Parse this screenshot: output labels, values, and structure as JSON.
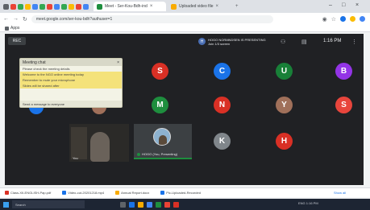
{
  "browser": {
    "tabs": [
      {
        "label": "Meet - Ser-Kou-Bdh-ind",
        "active": true,
        "favicon_color": "#1e8e3e"
      },
      {
        "label": "Uploaded video file",
        "active": false,
        "favicon_color": "#f9ab00"
      }
    ],
    "url": "meet.google.com/ser-kou-bdh?authuser=1",
    "bookmarks_label": "Apps"
  },
  "meet": {
    "title_chip": "REC",
    "presenter_line1": "HOGO NORMNDSEN IS PRESENTING",
    "presenter_line2": "Join 1/3 screen",
    "clock": "1:16 PM",
    "chat": {
      "header": "Meeting chat",
      "rows": [
        "Please check the meeting details",
        "Welcome to the NGO online meeting today",
        "Remember to mute your microphone",
        "Slides will be shared after"
      ],
      "footer": "Send a message to everyone"
    },
    "self_label": "You",
    "presenting_label": "HOGO (You, Presenting)",
    "participants": [
      {
        "initial": "S",
        "color": "#d93025"
      },
      {
        "initial": "C",
        "color": "#1a73e8"
      },
      {
        "initial": "U",
        "color": "#188038"
      },
      {
        "initial": "B",
        "color": "#9334e6"
      },
      {
        "initial": "M",
        "color": "#1e8e3e"
      },
      {
        "initial": "N",
        "color": "#d93025"
      },
      {
        "initial": "Y",
        "color": "#a0705a"
      },
      {
        "initial": "S",
        "color": "#e8453c"
      },
      {
        "initial": "K",
        "color": "#80868b"
      },
      {
        "initial": "H",
        "color": "#d93025"
      }
    ]
  },
  "downloads": {
    "items": [
      "Class-XII-ENGLISH-Pap.pdf",
      "Video-cut-20201218.mp4",
      "Annual Report.docx",
      "Pic-Uploaded-Recorded"
    ],
    "show_all": "Show all"
  },
  "taskbar": {
    "search_placeholder": "Search",
    "tray_text": "ENG  1:16 PM"
  }
}
